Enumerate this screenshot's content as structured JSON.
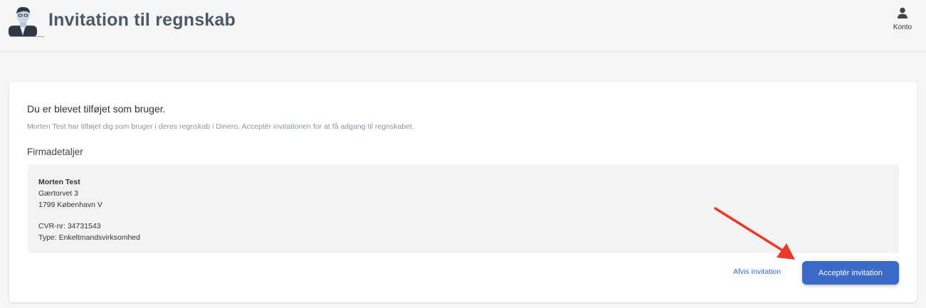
{
  "header": {
    "title": "Invitation til regnskab",
    "account_label": "Konto"
  },
  "invitation": {
    "headline": "Du er blevet tilføjet som bruger.",
    "description": "Morten Test har tilføjet dig som bruger i deres regnskab i Dinero. Acceptér invitationen for at få adgang til regnskabet.",
    "section_title": "Firmadetaljer",
    "company": {
      "name": "Morten Test",
      "street": "Gærtorvet 3",
      "city": "1799 København V",
      "cvr": "CVR-nr: 34731543",
      "type": "Type: Enkeltmandsvirksomhed"
    },
    "decline_label": "Afvis invitation",
    "accept_label": "Acceptér invitation"
  },
  "colors": {
    "accent": "#3a69c8",
    "title": "#4a5868",
    "annotation_arrow": "#e8392b"
  }
}
